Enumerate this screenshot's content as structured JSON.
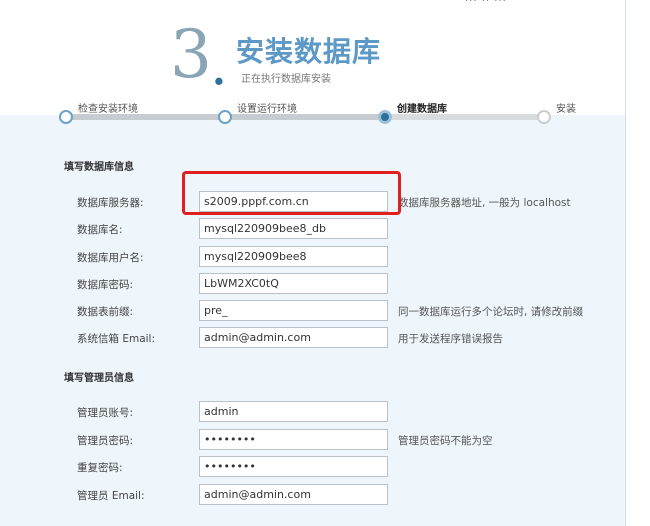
{
  "header": {
    "step_number": "3",
    "step_dot": ".",
    "title": "安装数据库",
    "subtitle": "正在执行数据库安装"
  },
  "steps": [
    {
      "label": "检查安装环境",
      "state": "done"
    },
    {
      "label": "设置运行环境",
      "state": "done"
    },
    {
      "label": "创建数据库",
      "state": "current"
    },
    {
      "label": "安装",
      "state": "pending"
    }
  ],
  "db_section": {
    "title": "填写数据库信息",
    "rows": [
      {
        "label": "数据库服务器:",
        "value": "s2009.pppf.com.cn",
        "hint": "数据库服务器地址, 一般为 localhost"
      },
      {
        "label": "数据库名:",
        "value": "mysql220909bee8_db",
        "hint": ""
      },
      {
        "label": "数据库用户名:",
        "value": "mysql220909bee8",
        "hint": ""
      },
      {
        "label": "数据库密码:",
        "value": "LbWM2XC0tQ",
        "hint": ""
      },
      {
        "label": "数据表前缀:",
        "value": "pre_",
        "hint": "同一数据库运行多个论坛时, 请修改前缀"
      },
      {
        "label": "系统信箱 Email:",
        "value": "admin@admin.com",
        "hint": "用于发送程序错误报告"
      }
    ]
  },
  "admin_section": {
    "title": "填写管理员信息",
    "rows": [
      {
        "label": "管理员账号:",
        "value": "admin",
        "hint": ""
      },
      {
        "label": "管理员密码:",
        "value": "••••••••",
        "hint": "管理员密码不能为空"
      },
      {
        "label": "重复密码:",
        "value": "••••••••",
        "hint": ""
      },
      {
        "label": "管理员 Email:",
        "value": "admin@admin.com",
        "hint": ""
      }
    ]
  },
  "colors": {
    "accent": "#5d99c6",
    "highlight": "#e02020",
    "panel_bg": "#eef6fb"
  }
}
